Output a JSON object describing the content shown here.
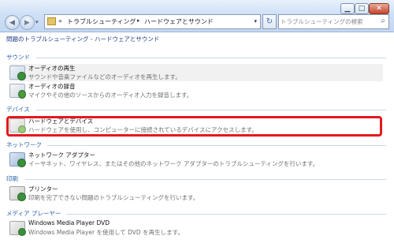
{
  "window": {
    "minimize_glyph": "▁",
    "maximize_glyph": "□",
    "close_glyph": "✕"
  },
  "nav": {
    "back_glyph": "◀",
    "forward_glyph": "▶",
    "history_glyph": "▾"
  },
  "address": {
    "chevron": "«",
    "crumbs": [
      "トラブルシューティング",
      "ハードウェアとサウンド"
    ],
    "separator": "▸",
    "dropdown_glyph": "▾"
  },
  "refresh_glyph": "↻",
  "search": {
    "placeholder": "トラブルシューティングの検索",
    "icon_glyph": "⌕"
  },
  "page_title": "問題のトラブルシューティング - ハードウェアとサウンド",
  "sections": [
    {
      "heading": "サウンド",
      "items": [
        {
          "title": "オーディオの再生",
          "desc": "サウンドや音楽ファイルなどのオーディオを再生します。",
          "icon": "audio-playback-icon"
        },
        {
          "title": "オーディオの録音",
          "desc": "マイクやその他のソースからのオーディオ入力を録音します。",
          "icon": "audio-recording-icon"
        }
      ]
    },
    {
      "heading": "デバイス",
      "items": [
        {
          "title": "ハードウェアとデバイス",
          "desc": "ハードウェアを使用し、コンピューターに接続されているデバイスにアクセスします。",
          "icon": "hardware-devices-icon"
        }
      ]
    },
    {
      "heading": "ネットワーク",
      "items": [
        {
          "title": "ネットワーク アダプター",
          "desc": "イーサネット、ワイヤレス、またはその他のネットワーク アダプターのトラブルシューティングを行います。",
          "icon": "network-adapter-icon"
        }
      ]
    },
    {
      "heading": "印刷",
      "items": [
        {
          "title": "プリンター",
          "desc": "印刷を完了できない問題のトラブルシューティングを行います。",
          "icon": "printer-icon"
        }
      ]
    },
    {
      "heading": "メディア プレーヤー",
      "items": [
        {
          "title": "Windows Media Player DVD",
          "desc": "Windows Media Player を使用して DVD を再生します。",
          "icon": "windows-media-player-dvd-icon"
        }
      ]
    }
  ],
  "colors": {
    "section_heading": "#2b5fa8",
    "highlight_border": "#e3191f"
  }
}
